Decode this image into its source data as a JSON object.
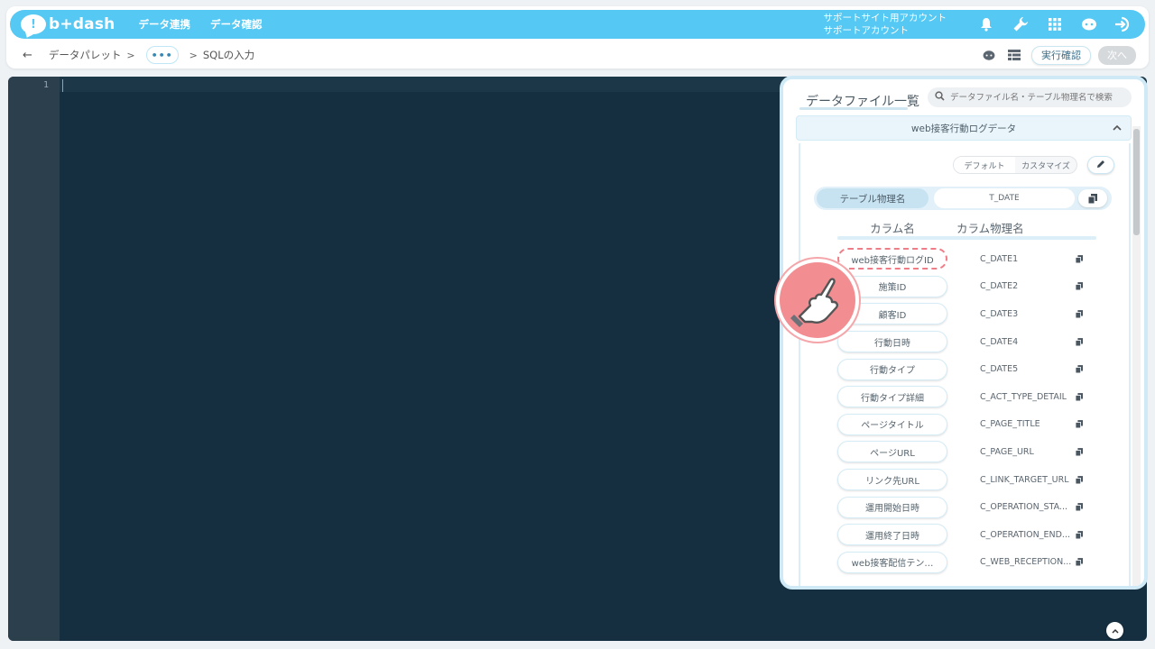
{
  "app": {
    "logo_text": "b+dash",
    "nav": [
      "データ連携",
      "データ確認"
    ],
    "account_line1": "サポートサイト用アカウント",
    "account_line2": "サポートアカウント",
    "top_icons": [
      "bell-icon",
      "wrench-icon",
      "grid-icon",
      "chat-bot-icon",
      "logout-icon"
    ]
  },
  "breadcrumb": {
    "back_icon": "arrow-left-icon",
    "item1": "データパレット",
    "sep": ">",
    "more": "•••",
    "current": "SQLの入力"
  },
  "actions": {
    "run_check": "実行確認",
    "next": "次へ"
  },
  "editor": {
    "line_number": "1"
  },
  "panel": {
    "title": "データファイル一覧",
    "search_placeholder": "データファイル名・テーブル物理名で検索",
    "file_name": "web接客行動ログデータ",
    "toggle_default": "デフォルト",
    "toggle_custom": "カスタマイズ",
    "table_label": "テーブル物理名",
    "table_value": "T_DATE",
    "header_col_name": "カラム名",
    "header_col_phys": "カラム物理名",
    "columns": [
      {
        "name": "web接客行動ログID",
        "phys": "C_DATE1"
      },
      {
        "name": "施策ID",
        "phys": "C_DATE2"
      },
      {
        "name": "顧客ID",
        "phys": "C_DATE3"
      },
      {
        "name": "行動日時",
        "phys": "C_DATE4"
      },
      {
        "name": "行動タイプ",
        "phys": "C_DATE5"
      },
      {
        "name": "行動タイプ詳細",
        "phys": "C_ACT_TYPE_DETAIL"
      },
      {
        "name": "ページタイトル",
        "phys": "C_PAGE_TITLE"
      },
      {
        "name": "ページURL",
        "phys": "C_PAGE_URL"
      },
      {
        "name": "リンク先URL",
        "phys": "C_LINK_TARGET_URL"
      },
      {
        "name": "運用開始日時",
        "phys": "C_OPERATION_STA..."
      },
      {
        "name": "運用終了日時",
        "phys": "C_OPERATION_END..."
      },
      {
        "name": "web接客配信テン…",
        "phys": "C_WEB_RECEPTION..."
      }
    ]
  },
  "colors": {
    "topbar": "#55c8f3",
    "editor_bg": "#152f41",
    "gutter_bg": "#2b3f4c",
    "highlight": "#ef7d87"
  }
}
